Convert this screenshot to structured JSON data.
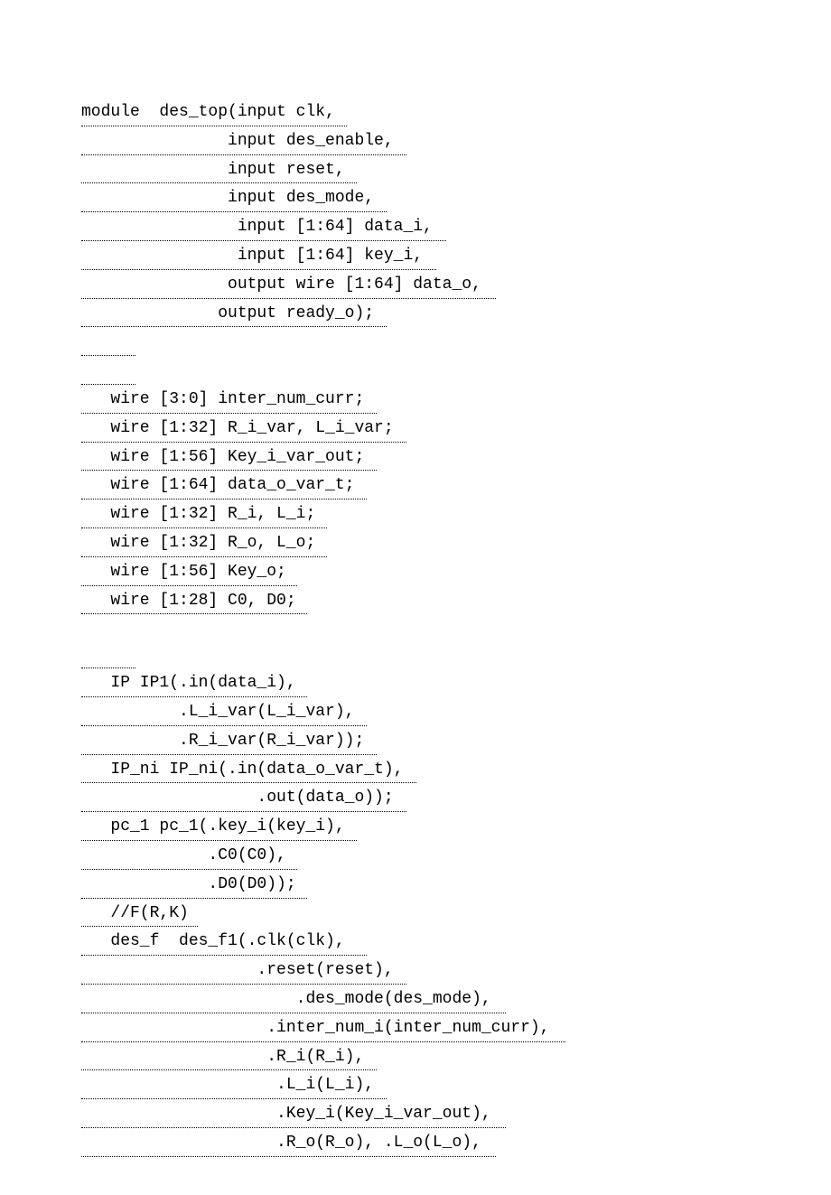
{
  "lines": [
    "module  des_top(input clk,",
    "               input des_enable,",
    "               input reset,",
    "               input des_mode,",
    "                input [1:64] data_i,",
    "                input [1:64] key_i,",
    "               output wire [1:64] data_o,",
    "              output ready_o);",
    "",
    "",
    "   wire [3:0] inter_num_curr;",
    "   wire [1:32] R_i_var, L_i_var;",
    "   wire [1:56] Key_i_var_out;",
    "   wire [1:64] data_o_var_t;",
    "   wire [1:32] R_i, L_i;",
    "   wire [1:32] R_o, L_o;",
    "   wire [1:56] Key_o;",
    "   wire [1:28] C0, D0;"
  ],
  "lines2": [
    "",
    "   IP IP1(.in(data_i),",
    "          .L_i_var(L_i_var),",
    "          .R_i_var(R_i_var));",
    "   IP_ni IP_ni(.in(data_o_var_t),",
    "                  .out(data_o));",
    "   pc_1 pc_1(.key_i(key_i),",
    "             .C0(C0),",
    "             .D0(D0));",
    "   //F(R,K)",
    "   des_f  des_f1(.clk(clk), ",
    "                  .reset(reset),",
    "                      .des_mode(des_mode),",
    "                   .inter_num_i(inter_num_curr),",
    "                   .R_i(R_i),",
    "                    .L_i(L_i),",
    "                    .Key_i(Key_i_var_out),",
    "                    .R_o(R_o), .L_o(L_o),"
  ]
}
